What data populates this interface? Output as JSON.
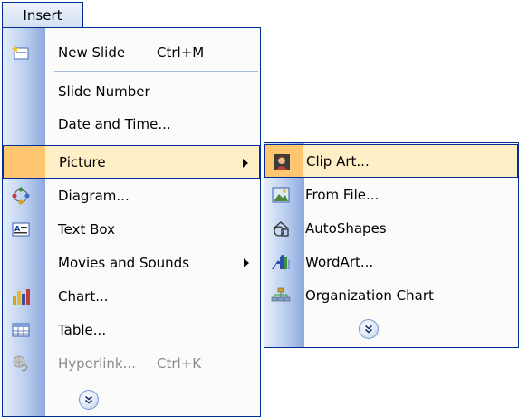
{
  "insert_tab": {
    "label": "Insert"
  },
  "main_menu": {
    "items": [
      {
        "label": "New Slide",
        "shortcut": "Ctrl+M",
        "icon": "new-slide-icon"
      },
      {
        "label": "Slide Number"
      },
      {
        "label": "Date and Time..."
      },
      {
        "label": "Picture",
        "submenu": true,
        "highlighted": true
      },
      {
        "label": "Diagram...",
        "icon": "diagram-icon"
      },
      {
        "label": "Text Box",
        "icon": "text-box-icon"
      },
      {
        "label": "Movies and Sounds",
        "submenu": true
      },
      {
        "label": "Chart...",
        "icon": "chart-icon"
      },
      {
        "label": "Table...",
        "icon": "table-icon"
      },
      {
        "label": "Hyperlink...",
        "shortcut": "Ctrl+K",
        "icon": "hyperlink-icon",
        "disabled": true
      }
    ],
    "expand_icon": "chevron-double-down-icon"
  },
  "picture_submenu": {
    "items": [
      {
        "label": "Clip Art...",
        "icon": "clip-art-icon",
        "highlighted": true
      },
      {
        "label": "From File...",
        "icon": "from-file-icon"
      },
      {
        "label": "AutoShapes",
        "icon": "autoshapes-icon"
      },
      {
        "label": "WordArt...",
        "icon": "wordart-icon"
      },
      {
        "label": "Organization Chart",
        "icon": "organization-chart-icon"
      }
    ],
    "expand_icon": "chevron-double-down-icon"
  },
  "colors": {
    "menu_border": "#002d96",
    "highlight": "#ffefc6",
    "highlight_gutter": "#ffc672",
    "gutter": "#b9cdef"
  }
}
